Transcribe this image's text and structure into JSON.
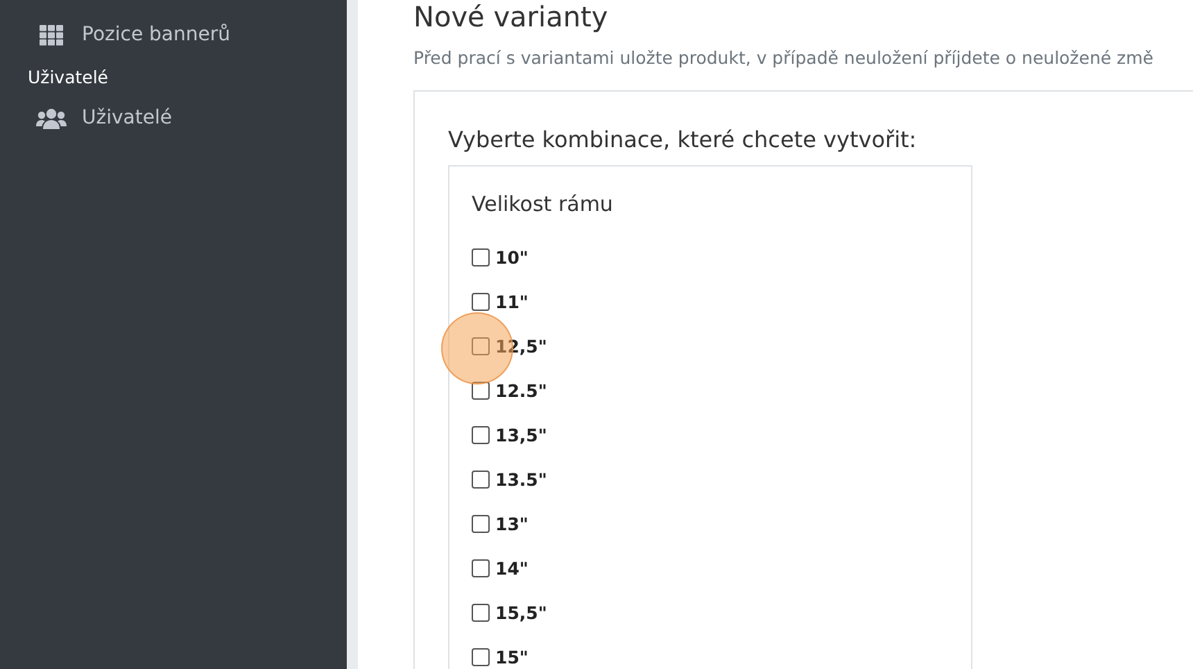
{
  "sidebar": {
    "items": [
      {
        "kind": "link",
        "label": "Pozice bannerů"
      },
      {
        "kind": "header",
        "label": "Uživatelé"
      },
      {
        "kind": "link",
        "label": "Uživatelé"
      }
    ]
  },
  "page": {
    "title": "Nové varianty",
    "note": "Před prací s variantami uložte produkt, v případě neuložení příjdete o neuložené změ"
  },
  "form": {
    "prompt": "Vyberte kombinace, které chcete vytvořit:",
    "group": {
      "title": "Velikost rámu",
      "options": [
        {
          "label": "10\"",
          "checked": false
        },
        {
          "label": "11\"",
          "checked": false
        },
        {
          "label": "12,5\"",
          "checked": false
        },
        {
          "label": "12.5\"",
          "checked": false
        },
        {
          "label": "13,5\"",
          "checked": false
        },
        {
          "label": "13.5\"",
          "checked": false
        },
        {
          "label": "13\"",
          "checked": false
        },
        {
          "label": "14\"",
          "checked": false
        },
        {
          "label": "15,5\"",
          "checked": false
        },
        {
          "label": "15\"",
          "checked": false
        }
      ]
    }
  }
}
